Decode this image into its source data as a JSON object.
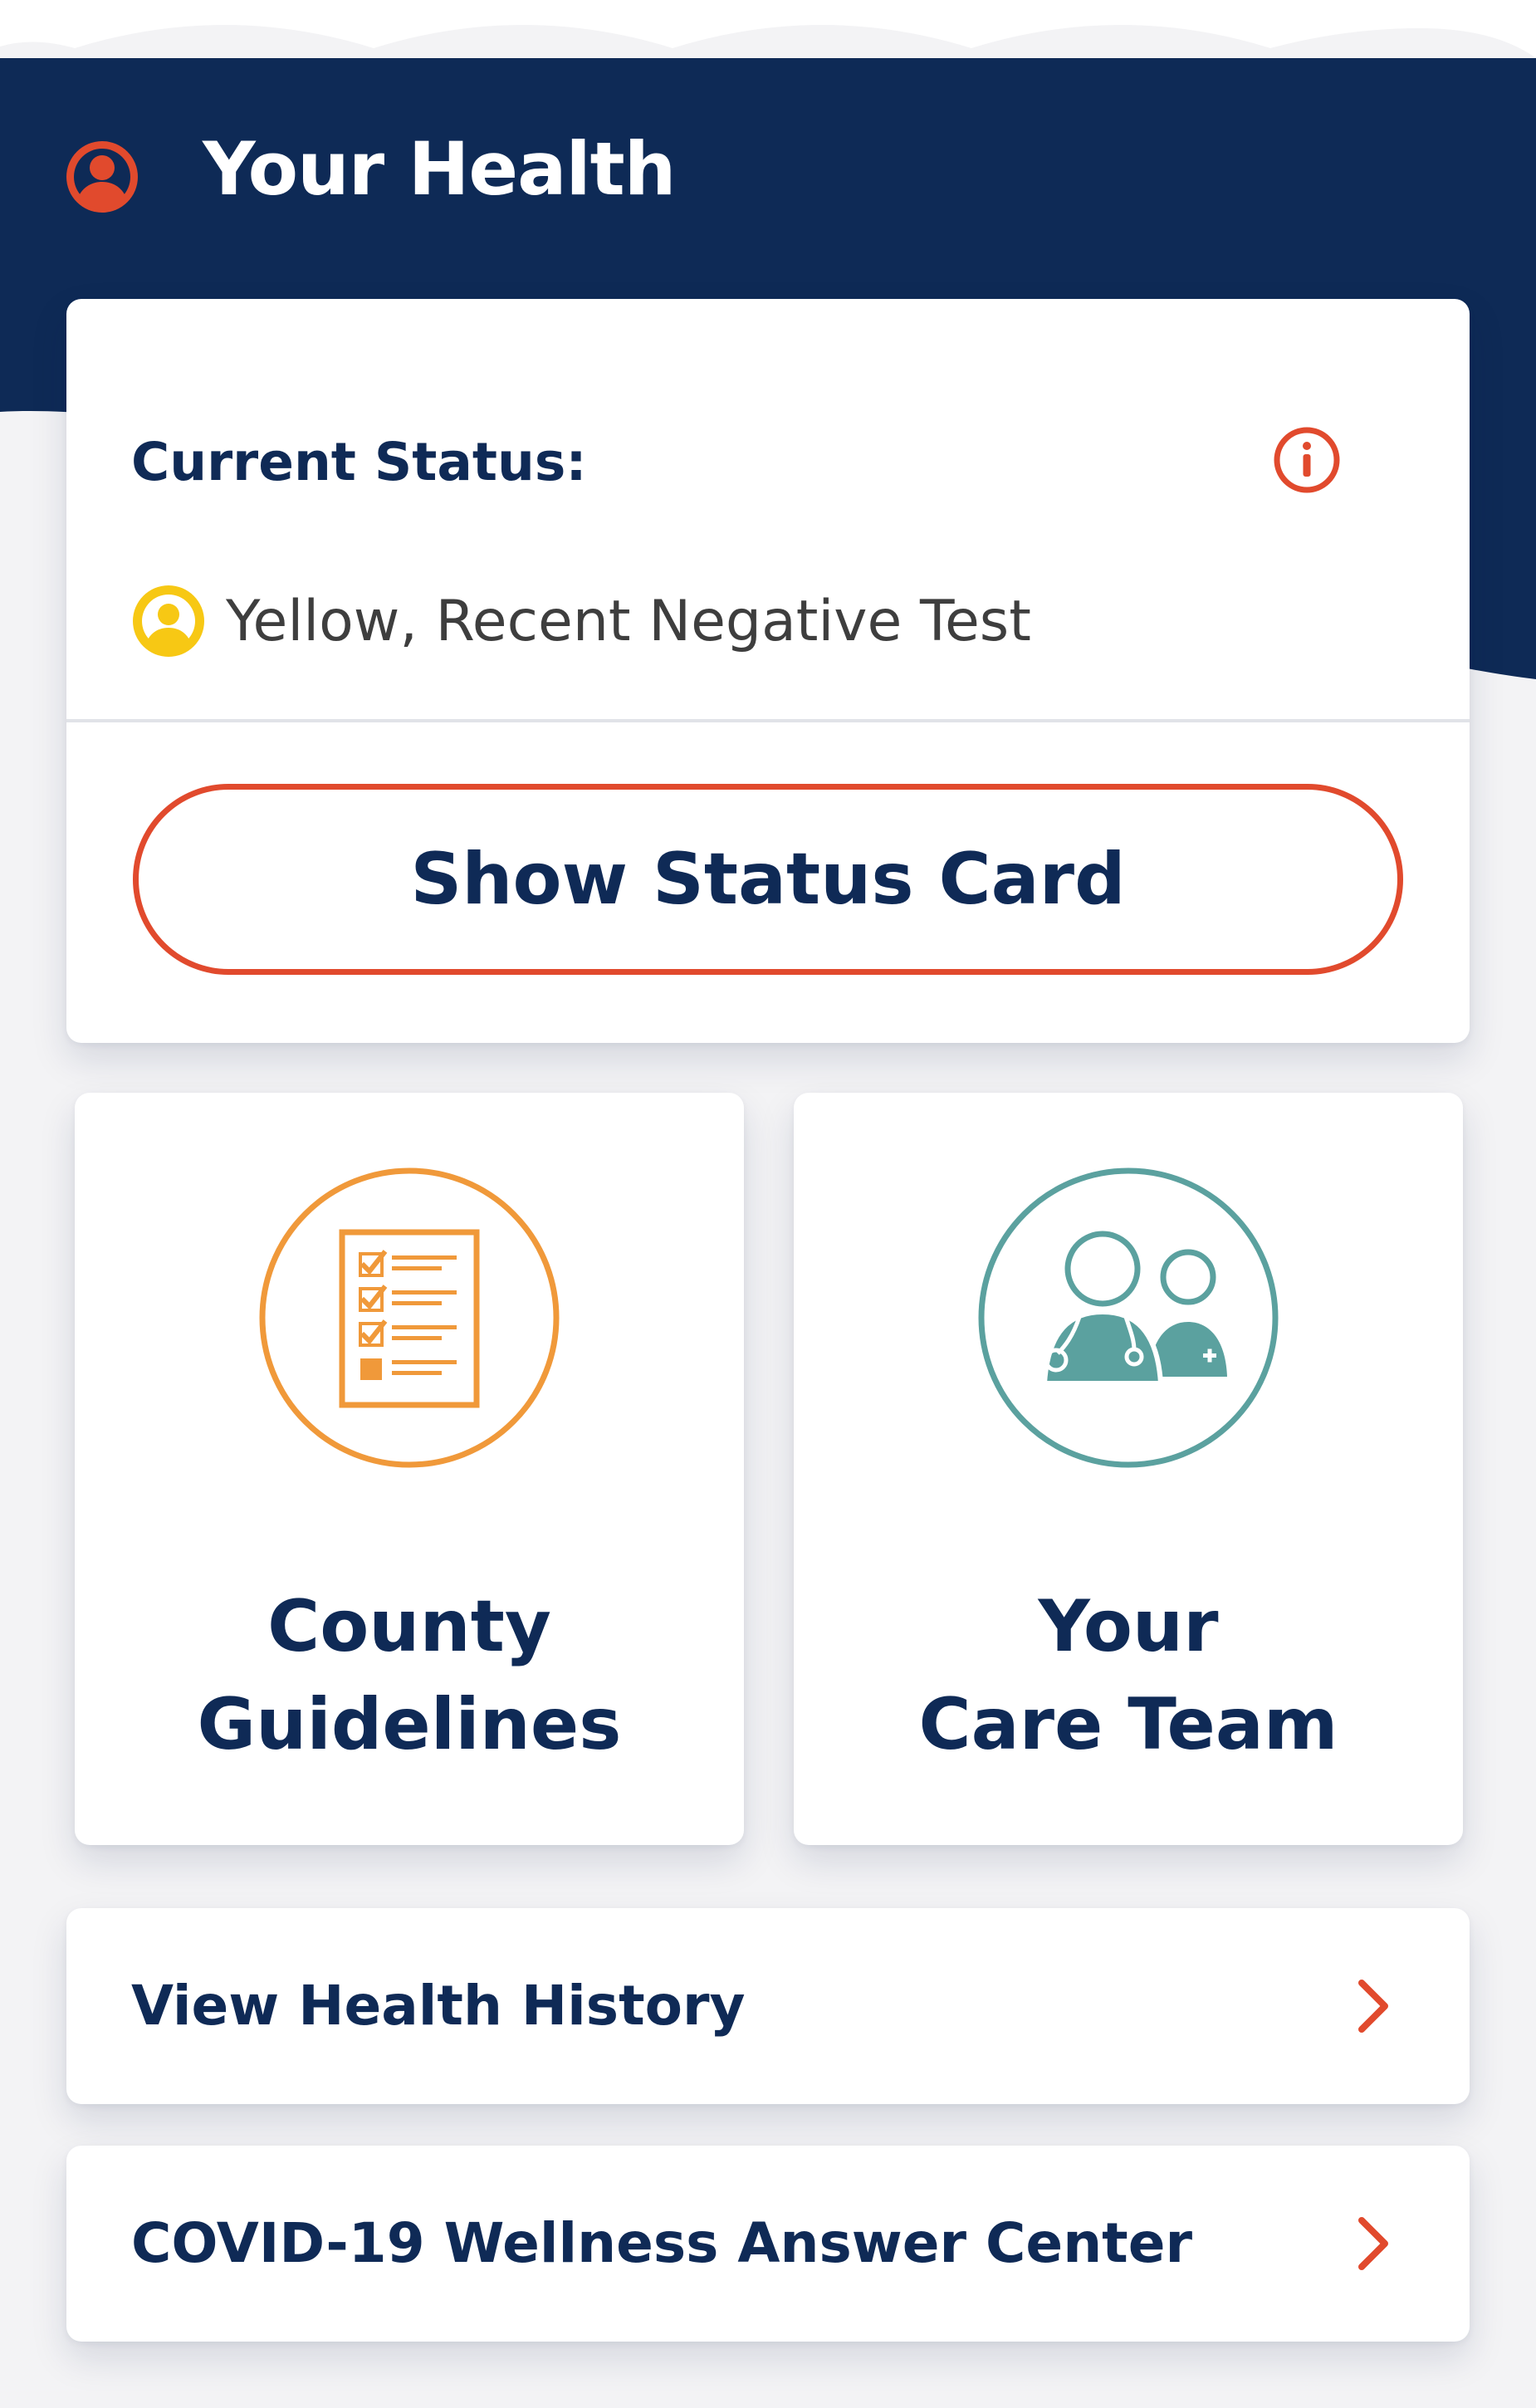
{
  "header": {
    "title": "Your Health",
    "icon": "user-circle-icon"
  },
  "status": {
    "label": "Current Status:",
    "value": "Yellow, Recent Negative Test",
    "status_color": "#f7c814",
    "info_icon": "info-icon",
    "button_label": "Show Status Card"
  },
  "tiles": [
    {
      "line1": "County",
      "line2": "Guidelines",
      "icon": "checklist-icon",
      "accent": "#f0993a"
    },
    {
      "line1": "Your",
      "line2": "Care Team",
      "icon": "doctors-icon",
      "accent": "#5ba19f"
    }
  ],
  "links": [
    {
      "label": "View Health History",
      "icon": "chevron-right-icon"
    },
    {
      "label": "COVID-19 Wellness Answer Center",
      "icon": "chevron-right-icon"
    }
  ],
  "colors": {
    "navy": "#0f2a56",
    "accent_red": "#e14a2d",
    "background": "#f3f3f5"
  }
}
